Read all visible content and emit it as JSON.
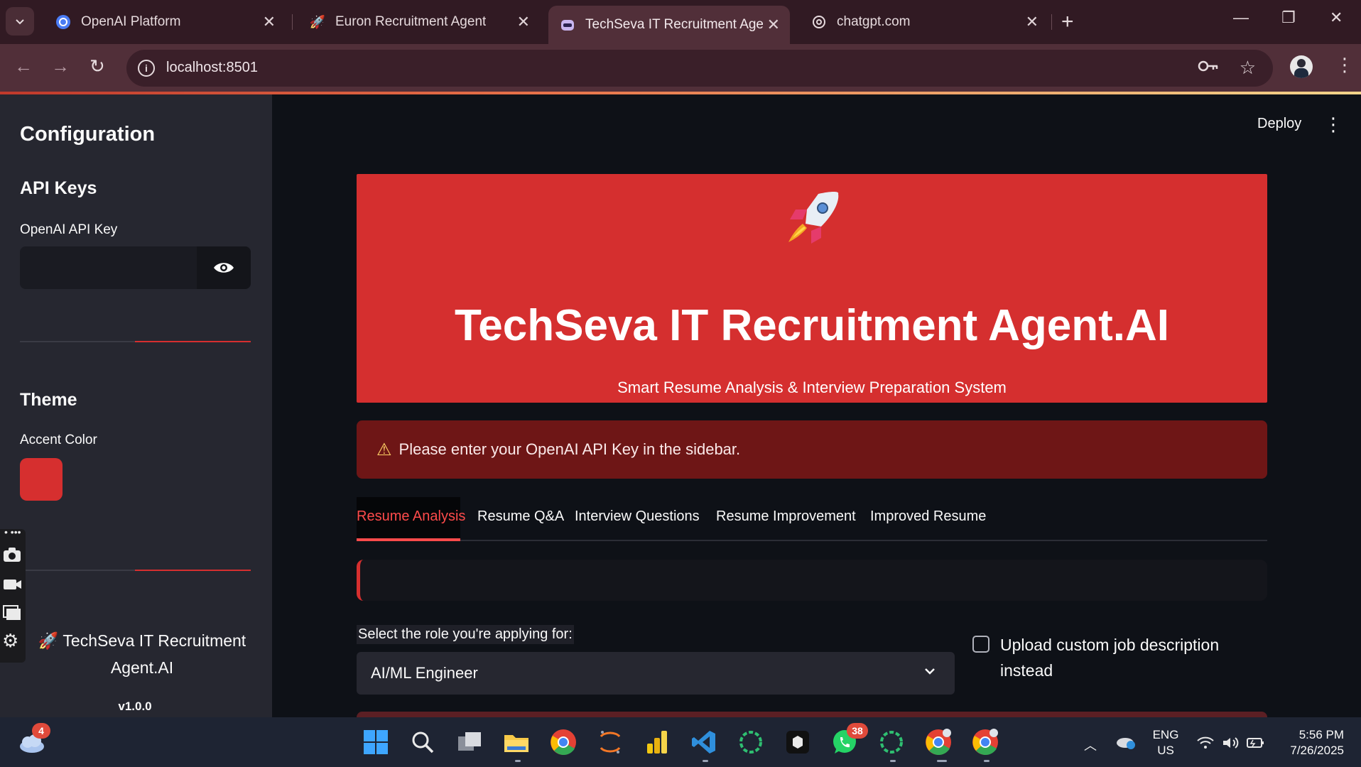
{
  "browser": {
    "tabs": [
      {
        "title": "OpenAI Platform",
        "favicon": "openai-icon"
      },
      {
        "title": "Euron Recruitment Agent",
        "favicon": "rocket-icon"
      },
      {
        "title": "TechSeva IT Recruitment Agent.",
        "favicon": "robot-icon",
        "active": true
      },
      {
        "title": "chatgpt.com",
        "favicon": "openai-icon"
      }
    ],
    "url": "localhost:8501"
  },
  "sidebar": {
    "heading": "Configuration",
    "api_keys_heading": "API Keys",
    "api_key_label": "OpenAI API Key",
    "api_key_value": "",
    "theme_heading": "Theme",
    "accent_label": "Accent Color",
    "accent_color": "#d62f2f",
    "footer_title": "TechSeva IT Recruitment Agent.AI",
    "footer_icon": "🚀",
    "version": "v1.0.0"
  },
  "header": {
    "deploy_label": "Deploy"
  },
  "hero": {
    "title": "TechSeva IT Recruitment Agent.AI",
    "subtitle": "Smart Resume Analysis & Interview Preparation System",
    "background": "#d52f2f"
  },
  "warning": {
    "text": "Please enter your OpenAI API Key in the sidebar."
  },
  "tabs": [
    {
      "label": "Resume Analysis",
      "active": true
    },
    {
      "label": "Resume Q&A"
    },
    {
      "label": "Interview Questions"
    },
    {
      "label": "Resume Improvement"
    },
    {
      "label": "Improved Resume"
    }
  ],
  "role_select": {
    "label": "Select the role you're applying for:",
    "value": "AI/ML Engineer"
  },
  "custom_jd": {
    "label": "Upload custom job description instead",
    "checked": false
  },
  "taskbar": {
    "weather_badge": "4",
    "whatsapp_badge": "38",
    "lang_line1": "ENG",
    "lang_line2": "US",
    "time": "5:56 PM",
    "date": "7/26/2025"
  }
}
